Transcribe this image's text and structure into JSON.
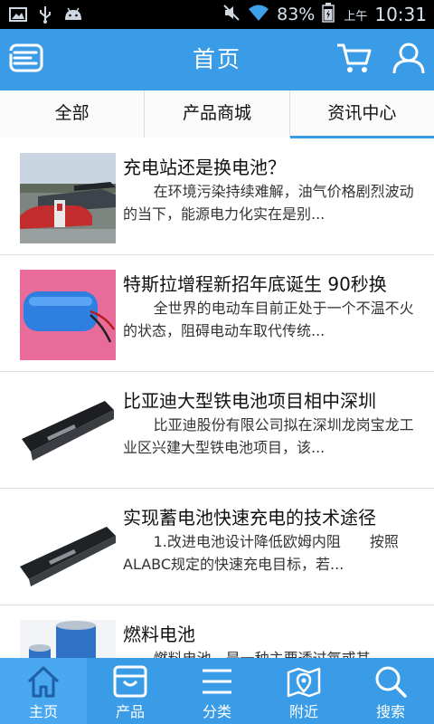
{
  "status_bar": {
    "battery_percent": "83%",
    "ampm": "上午",
    "time": "10:31"
  },
  "header": {
    "title": "首页",
    "left_icon": "menu-icon",
    "right_icons": [
      "cart-icon",
      "user-icon"
    ]
  },
  "tabs": [
    {
      "label": "全部",
      "active": false
    },
    {
      "label": "产品商城",
      "active": false
    },
    {
      "label": "资讯中心",
      "active": true
    }
  ],
  "news": [
    {
      "title": "充电站还是换电池？",
      "summary": "在环境污染持续难解，油气价格剧烈波动的当下，能源电力化实在是别..."
    },
    {
      "title": "特斯拉增程新招年底诞生 90秒换",
      "summary": "全世界的电动车目前正处于一个不温不火的状态，阻碍电动车取代传统..."
    },
    {
      "title": "比亚迪大型铁电池项目相中深圳",
      "summary": "比亚迪股份有限公司拟在深圳龙岗宝龙工业区兴建大型铁电池项目，该..."
    },
    {
      "title": "实现蓄电池快速充电的技术途径",
      "summary": "1.改进电池设计降低欧姆内阻　　按照ALABC规定的快速充电目标，若..."
    },
    {
      "title": "燃料电池",
      "summary": "燃料电池，是一种主要透过氧或其..."
    }
  ],
  "bottom_nav": [
    {
      "label": "主页",
      "icon": "home-icon",
      "active": true
    },
    {
      "label": "产品",
      "icon": "product-icon",
      "active": false
    },
    {
      "label": "分类",
      "icon": "category-icon",
      "active": false
    },
    {
      "label": "附近",
      "icon": "map-icon",
      "active": false
    },
    {
      "label": "搜索",
      "icon": "search-icon",
      "active": false
    }
  ],
  "colors": {
    "brand": "#3a9be7",
    "status_bar": "#000000"
  }
}
